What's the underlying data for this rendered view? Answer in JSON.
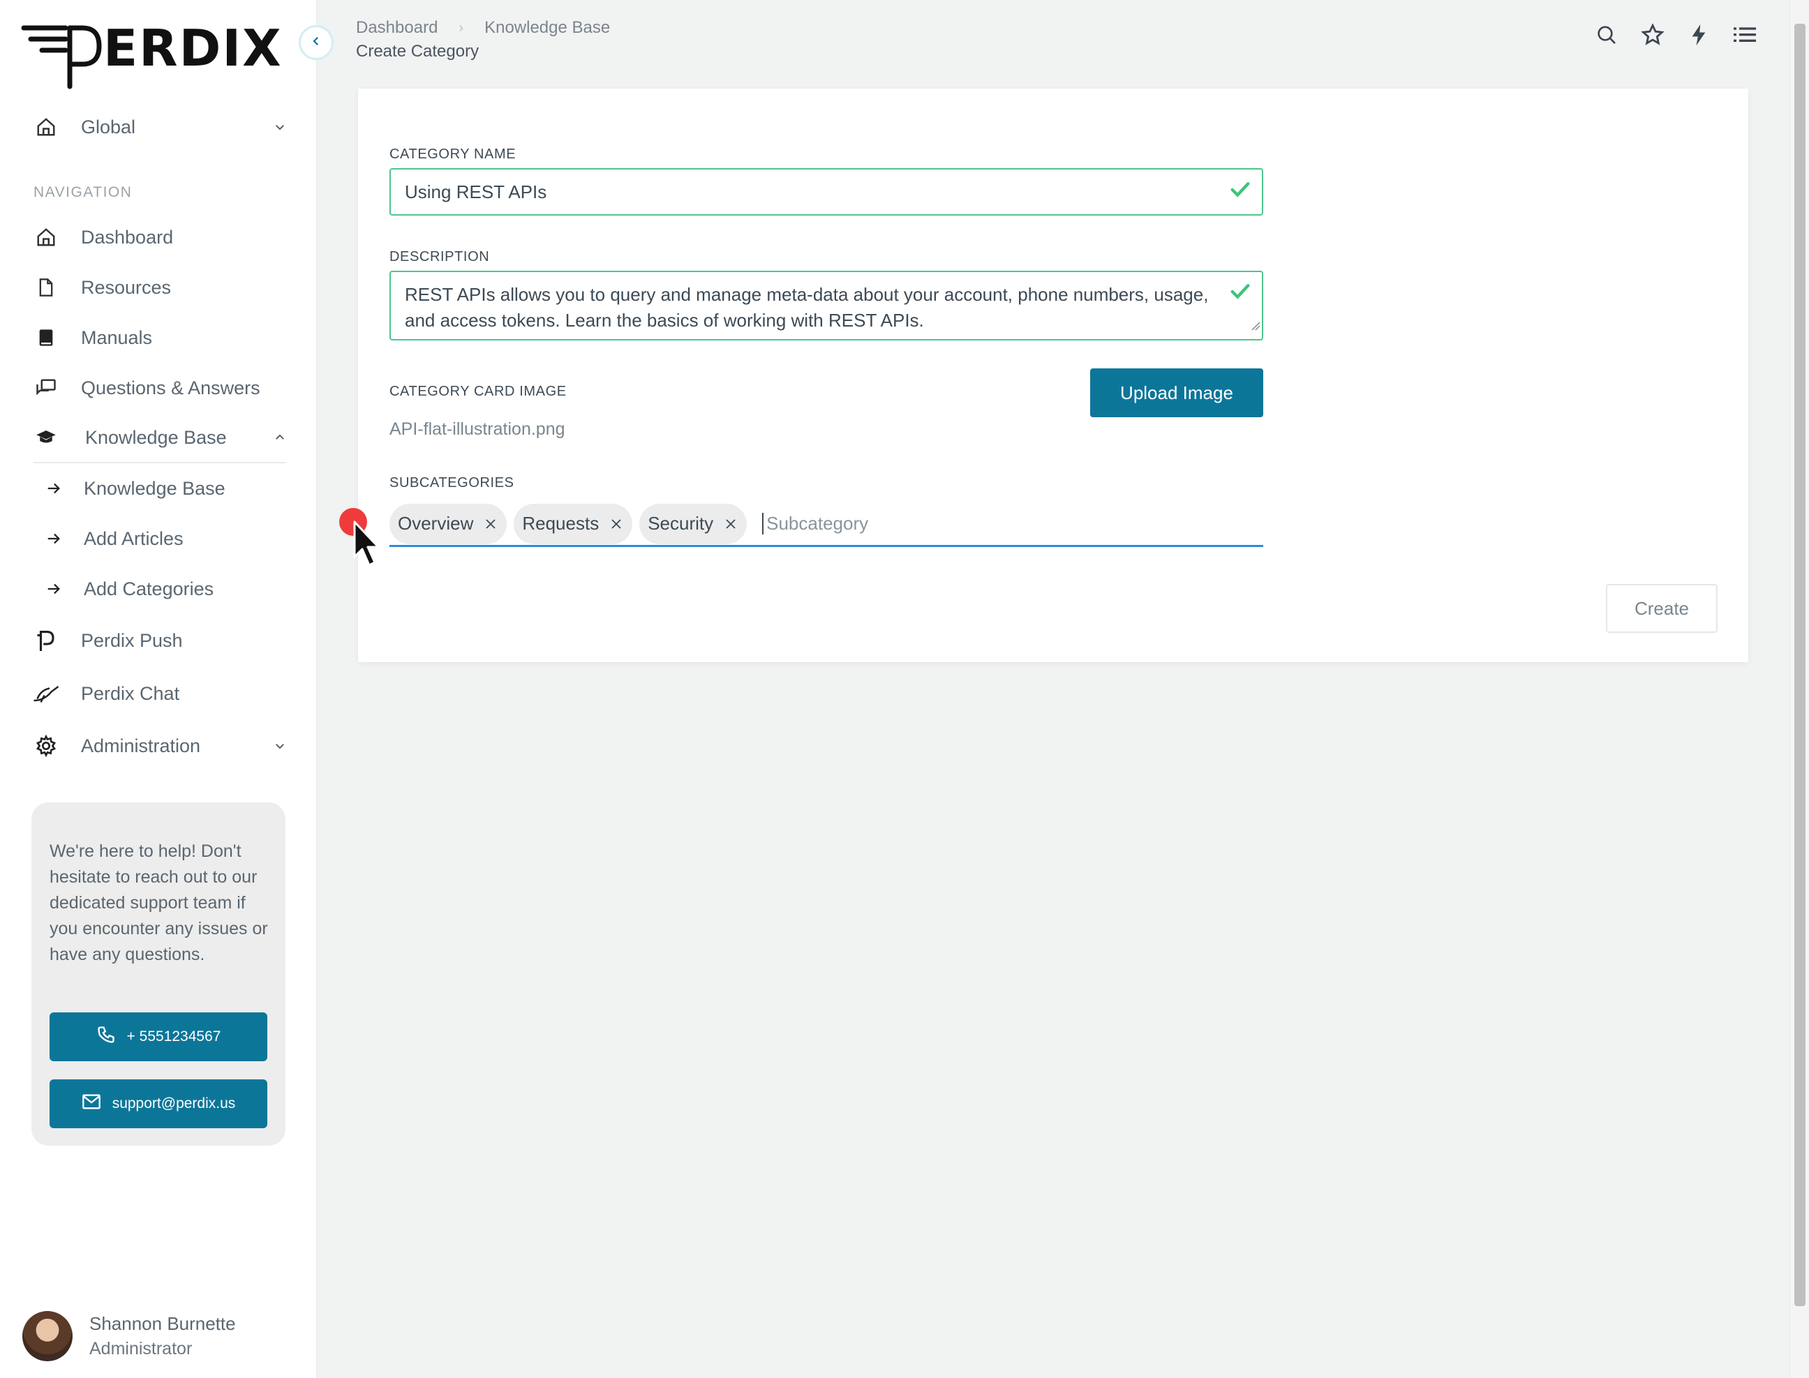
{
  "brand": {
    "logo_text": "PERDIX"
  },
  "sidebar": {
    "workspace": "Global",
    "section_label": "NAVIGATION",
    "items": [
      {
        "label": "Dashboard",
        "icon": "home-icon"
      },
      {
        "label": "Resources",
        "icon": "file-icon"
      },
      {
        "label": "Manuals",
        "icon": "book-icon"
      },
      {
        "label": "Questions & Answers",
        "icon": "chat-icon"
      },
      {
        "label": "Knowledge Base",
        "icon": "graduation-cap-icon",
        "expanded": true
      },
      {
        "label": "Knowledge Base",
        "icon": "arrow-right-icon",
        "sub": true
      },
      {
        "label": "Add Articles",
        "icon": "arrow-right-icon",
        "sub": true
      },
      {
        "label": "Add Categories",
        "icon": "arrow-right-icon",
        "sub": true
      },
      {
        "label": "Perdix Push",
        "icon": "perdix-p-icon"
      },
      {
        "label": "Perdix Chat",
        "icon": "bird-icon"
      },
      {
        "label": "Administration",
        "icon": "gear-icon"
      }
    ],
    "help": {
      "text": "We're here to help! Don't hesitate to reach out to our dedicated support team if you encounter any issues or have any questions.",
      "phone": "+ 5551234567",
      "email": "support@perdix.us"
    },
    "user": {
      "name": "Shannon Burnette",
      "role": "Administrator"
    }
  },
  "header": {
    "breadcrumb": [
      "Dashboard",
      "Knowledge Base"
    ],
    "title": "Create Category"
  },
  "form": {
    "name_label": "CATEGORY NAME",
    "name_value": "Using REST APIs",
    "description_label": "DESCRIPTION",
    "description_value": "REST APIs allows you to query and manage meta-data about your account, phone numbers, usage, and access tokens. Learn the basics of working with REST APIs.",
    "image_label": "CATEGORY CARD IMAGE",
    "upload_label": "Upload Image",
    "image_filename": "API-flat-illustration.png",
    "subcategories_label": "SUBCATEGORIES",
    "subcategories": [
      "Overview",
      "Requests",
      "Security"
    ],
    "subcategory_placeholder": "Subcategory",
    "create_label": "Create"
  },
  "colors": {
    "accent": "#0c7699",
    "valid": "#4cc68c",
    "focus": "#2f8ad9"
  }
}
